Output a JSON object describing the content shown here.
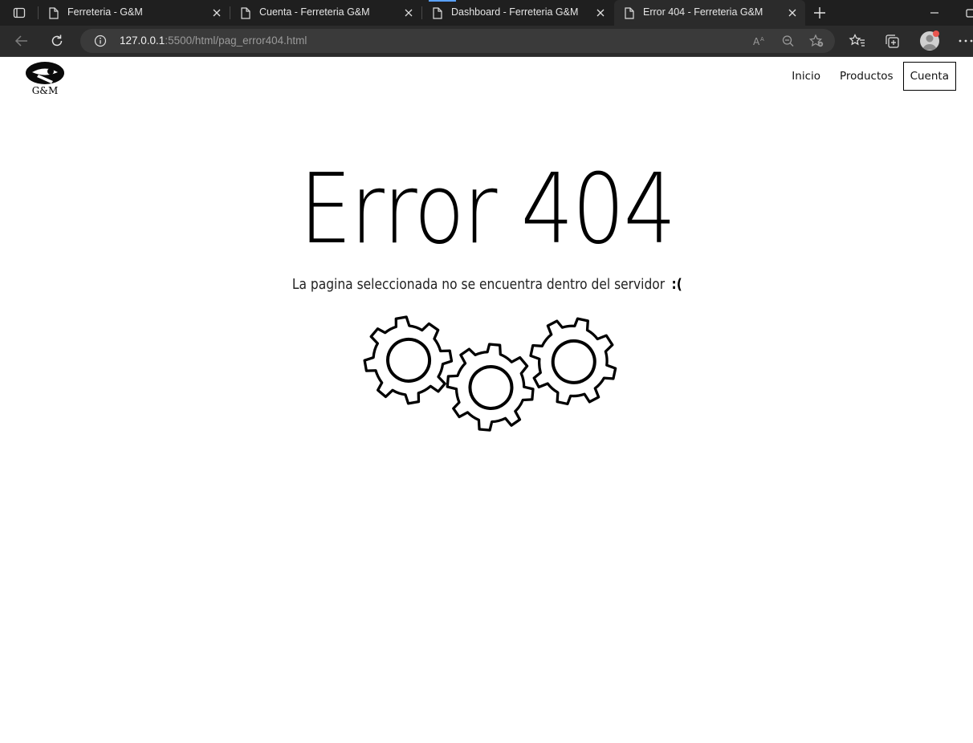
{
  "browser": {
    "tabs": [
      {
        "title": "Ferreteria - G&M",
        "active": false
      },
      {
        "title": "Cuenta - Ferreteria G&M",
        "active": false
      },
      {
        "title": "Dashboard - Ferreteria G&M",
        "active": false
      },
      {
        "title": "Error 404 - Ferreteria G&M",
        "active": true
      }
    ],
    "url_host": "127.0.0.1",
    "url_rest": ":5500/html/pag_error404.html",
    "icons": [
      "tab-actions-icon",
      "page-icon",
      "close-icon",
      "new-tab-icon",
      "minimize-icon",
      "restore-icon",
      "back-icon",
      "reload-icon",
      "info-icon",
      "read-aloud-icon",
      "zoom-out-icon",
      "add-favorite-icon",
      "favorites-icon",
      "collections-icon",
      "profile-avatar",
      "more-icon"
    ],
    "accent": "#5aa1ff"
  },
  "site": {
    "logo_text": "G&M",
    "nav": {
      "inicio": "Inicio",
      "productos": "Productos",
      "cuenta": "Cuenta"
    }
  },
  "main": {
    "title": "Error 404",
    "subtitle": "La pagina seleccionada no se encuentra dentro del servidor",
    "sad_face": ":(",
    "illustration": "gears-icon"
  }
}
